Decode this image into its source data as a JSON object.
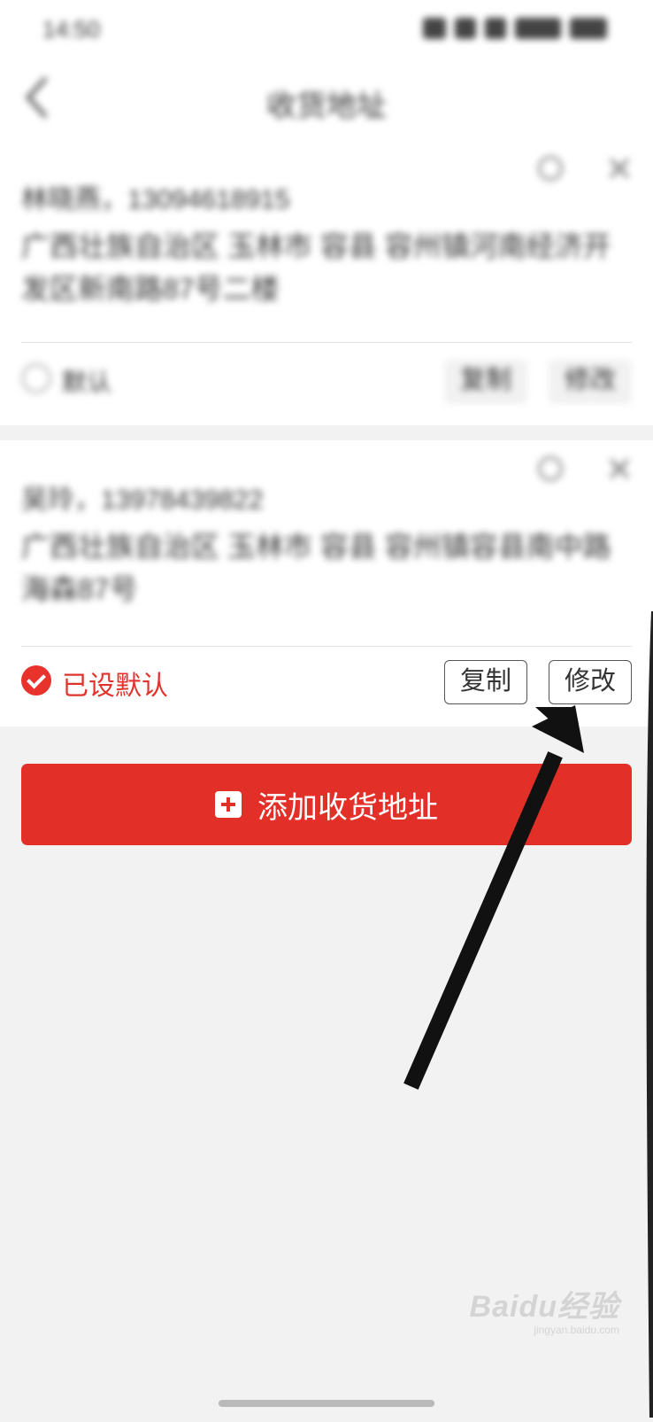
{
  "status_bar": {
    "time": "14:50"
  },
  "header": {
    "title": "收货地址",
    "back_icon": "chevron-left-icon"
  },
  "addresses": [
    {
      "contact": "林晓燕，13094618915",
      "address": "广西壮族自治区 玉林市 容县 容州镇河南经济开发区新南路87号二楼",
      "default_label": "默认",
      "copy_label": "复制",
      "edit_label": "修改"
    },
    {
      "contact": "吴玲，13978439822",
      "address": "广西壮族自治区 玉林市 容县 容州镇容县南中路海森87号",
      "default_label": "已设默认",
      "copy_label": "复制",
      "edit_label": "修改"
    }
  ],
  "add_button": {
    "label": "添加收货地址",
    "icon": "plus-square-icon"
  },
  "watermark": {
    "brand": "Baidu经验",
    "url": "jingyan.baidu.com"
  },
  "colors": {
    "accent": "#e22f27",
    "page_bg": "#f2f2f2",
    "card_bg": "#ffffff",
    "annotation": "#111111"
  }
}
